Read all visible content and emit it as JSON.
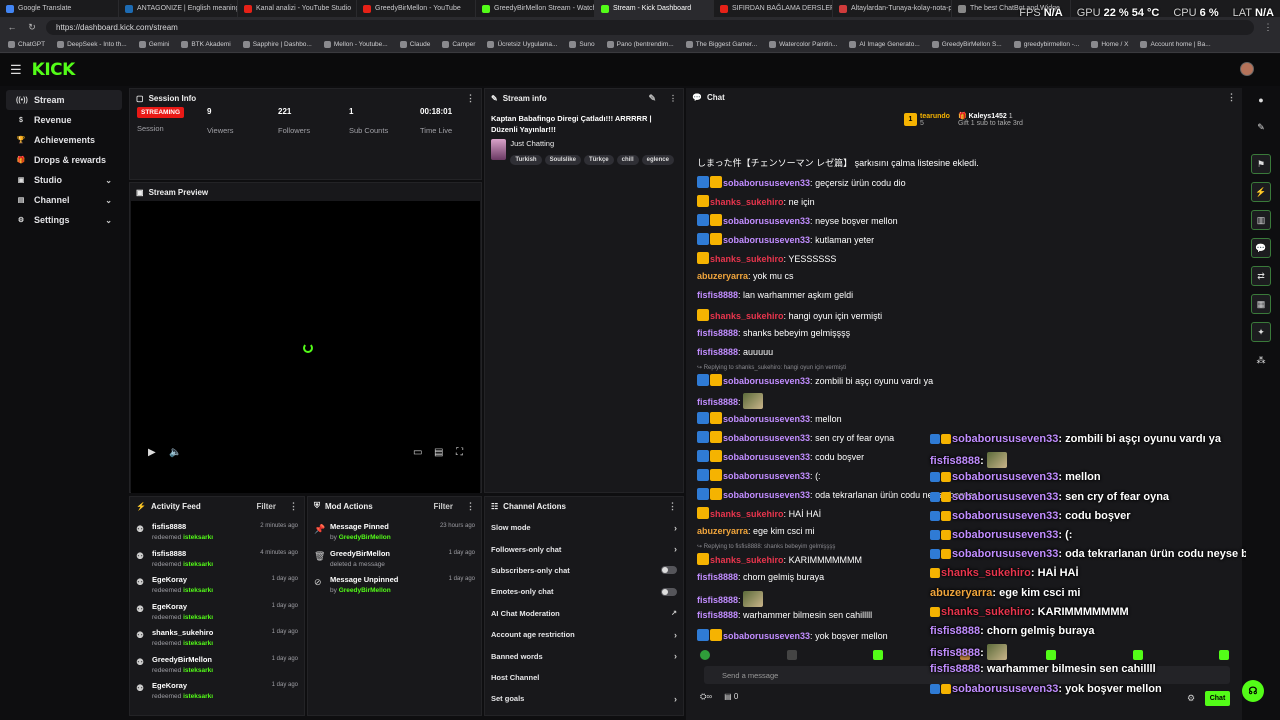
{
  "browser": {
    "tabs": [
      {
        "title": "Google Translate",
        "color": "#4285f4"
      },
      {
        "title": "ANTAGONIZE | English meaning -",
        "color": "#1d6bb3"
      },
      {
        "title": "Kanal analizi - YouTube Studio",
        "color": "#e62117"
      },
      {
        "title": "GreedyBirMellon - YouTube",
        "color": "#e62117"
      },
      {
        "title": "GreedyBirMellon Stream - Watch",
        "color": "#53fc18"
      },
      {
        "title": "Stream - Kick Dashboard",
        "color": "#53fc18"
      },
      {
        "title": "SIFIRDAN BAĞLAMA DERSLERİ 6 (",
        "color": "#e62117"
      },
      {
        "title": "Altaylardan-Tunaya-kolay-nota-p",
        "color": "#d03b3b"
      },
      {
        "title": "The best ChatBot and Widge",
        "color": "#888888"
      }
    ],
    "url": "https://dashboard.kick.com/stream",
    "bookmarks": [
      "ChatGPT",
      "DeepSeek - Into th...",
      "Gemini",
      "BTK Akademi",
      "Sapphire | Dashbo...",
      "Mellon - Youtube...",
      "Claude",
      "Camper",
      "Ücretsiz Uygulama...",
      "Suno",
      "Pano (bentrendim...",
      "The Biggest Gamer...",
      "Watercolor Paintin...",
      "AI Image Generato...",
      "GreedyBirMellon S...",
      "greedybirmellon -...",
      "Home / X",
      "Account home | Ba..."
    ]
  },
  "overlay_stats": {
    "fps_label": "FPS",
    "fps": "N/A",
    "gpu_label": "GPU",
    "gpu": "22 % 54 °C",
    "cpu_label": "CPU",
    "cpu": "6 %",
    "lat_label": "LAT",
    "lat": "N/A"
  },
  "app": {
    "logo": "KICK"
  },
  "sidebar": {
    "items": [
      {
        "label": "Stream",
        "icon": "radio-icon",
        "active": true
      },
      {
        "label": "Revenue",
        "icon": "dollar-icon"
      },
      {
        "label": "Achievements",
        "icon": "trophy-icon"
      },
      {
        "label": "Drops & rewards",
        "icon": "gift-icon"
      },
      {
        "label": "Studio",
        "icon": "studio-icon",
        "chev": true
      },
      {
        "label": "Channel",
        "icon": "channel-icon",
        "chev": true
      },
      {
        "label": "Settings",
        "icon": "gear-icon",
        "chev": true
      }
    ]
  },
  "session": {
    "title": "Session Info",
    "status": "STREAMING",
    "status_label": "Session",
    "viewers": "9",
    "viewers_label": "Viewers",
    "followers": "221",
    "followers_label": "Followers",
    "subs": "1",
    "subs_label": "Sub Counts",
    "time": "00:18:01",
    "time_label": "Time Live"
  },
  "preview": {
    "title": "Stream Preview"
  },
  "stream_info": {
    "title": "Stream info",
    "stream_title": "Kaptan Babafingo Diregi Çatladı!!! ARRRRR | Düzenli Yayınlar!!!",
    "category": "Just Chatting",
    "tags": [
      "Turkish",
      "Soulslike",
      "Türkçe",
      "chill",
      "eglence"
    ]
  },
  "activity": {
    "title": "Activity Feed",
    "filter": "Filter",
    "items": [
      {
        "name": "fisfis8888",
        "action": "redeemed",
        "reward": "isteksarkı",
        "time": "2 minutes ago"
      },
      {
        "name": "fisfis8888",
        "action": "redeemed",
        "reward": "isteksarkı",
        "time": "4 minutes ago"
      },
      {
        "name": "EgeKoray",
        "action": "redeemed",
        "reward": "isteksarkı",
        "time": "1 day ago"
      },
      {
        "name": "EgeKoray",
        "action": "redeemed",
        "reward": "isteksarkı",
        "time": "1 day ago"
      },
      {
        "name": "shanks_sukehiro",
        "action": "redeemed",
        "reward": "isteksarkı",
        "time": "1 day ago"
      },
      {
        "name": "GreedyBirMellon",
        "action": "redeemed",
        "reward": "isteksarkı",
        "time": "1 day ago"
      },
      {
        "name": "EgeKoray",
        "action": "redeemed",
        "reward": "isteksarkı",
        "time": "1 day ago"
      }
    ]
  },
  "mod": {
    "title": "Mod Actions",
    "filter": "Filter",
    "items": [
      {
        "title": "Message Pinned",
        "by": "by",
        "user": "GreedyBirMellon",
        "time": "23 hours ago",
        "icon": "pin-icon"
      },
      {
        "title": "GreedyBirMellon",
        "by": "deleted a message",
        "user": "",
        "time": "1 day ago",
        "icon": "trash-icon"
      },
      {
        "title": "Message Unpinned",
        "by": "by",
        "user": "GreedyBirMellon",
        "time": "1 day ago",
        "icon": "unpin-icon"
      }
    ]
  },
  "channel_actions": {
    "title": "Channel Actions",
    "items": [
      {
        "label": "Slow mode",
        "kind": "arrow"
      },
      {
        "label": "Followers-only chat",
        "kind": "arrow"
      },
      {
        "label": "Subscribers-only chat",
        "kind": "toggle"
      },
      {
        "label": "Emotes-only chat",
        "kind": "toggle"
      },
      {
        "label": "AI Chat Moderation",
        "kind": "ext"
      },
      {
        "label": "Account age restriction",
        "kind": "arrow"
      },
      {
        "label": "Banned words",
        "kind": "arrow"
      },
      {
        "label": "Host Channel",
        "kind": "none"
      },
      {
        "label": "Set goals",
        "kind": "arrow"
      }
    ]
  },
  "chat": {
    "title": "Chat",
    "top_gifter": {
      "rank": "1",
      "name": "tearundo",
      "count": "5"
    },
    "sub_goal": {
      "name": "Kaleys1452",
      "count": "1",
      "text": "Gift 1 sub to take 3rd"
    },
    "bot_line": "しまった件【チェンソーマン レゼ篇】 şarkısını çalma listesine ekledi.",
    "messages": [
      {
        "user": "sobaborususeven33",
        "text": "geçersiz ürün codu dio",
        "color": "#c18dff",
        "badges": [
          "blue",
          "gold"
        ]
      },
      {
        "user": "shanks_sukehiro",
        "text": "ne için",
        "color": "#e8354d",
        "badges": [
          "gold"
        ]
      },
      {
        "user": "sobaborususeven33",
        "text": "neyse boşver mellon",
        "color": "#c18dff",
        "badges": [
          "blue",
          "gold"
        ]
      },
      {
        "user": "sobaborususeven33",
        "text": "kutlaman yeter",
        "color": "#c18dff",
        "badges": [
          "blue",
          "gold"
        ]
      },
      {
        "user": "shanks_sukehiro",
        "text": "YESSSSSS",
        "color": "#e8354d",
        "badges": [
          "gold"
        ]
      },
      {
        "user": "abuzeryarra",
        "text": "yok mu cs",
        "color": "#f0a53c",
        "badges": []
      },
      {
        "user": "fisfis8888",
        "text": "lan warhammer aşkım geldi",
        "color": "#c18dff",
        "badges": []
      },
      {
        "user": "shanks_sukehiro",
        "text": "hangi oyun için vermişti",
        "color": "#e8354d",
        "badges": [
          "gold"
        ]
      },
      {
        "user": "fisfis8888",
        "text": "shanks bebeyim gelmişşşş",
        "color": "#c18dff",
        "badges": []
      },
      {
        "user": "fisfis8888",
        "text": "auuuuu",
        "color": "#c18dff",
        "badges": []
      },
      {
        "user": "sobaborususeven33",
        "text": "zombili bi aşçı oyunu vardı ya",
        "color": "#c18dff",
        "badges": [
          "blue",
          "gold"
        ],
        "reply": "Replying to shanks_sukehiro: hangi oyun için vermişti"
      },
      {
        "user": "fisfis8888",
        "text": "",
        "color": "#c18dff",
        "badges": [],
        "emote": true
      },
      {
        "user": "sobaborususeven33",
        "text": "mellon",
        "color": "#c18dff",
        "badges": [
          "blue",
          "gold"
        ]
      },
      {
        "user": "sobaborususeven33",
        "text": "sen cry of fear oyna",
        "color": "#c18dff",
        "badges": [
          "blue",
          "gold"
        ]
      },
      {
        "user": "sobaborususeven33",
        "text": "codu boşver",
        "color": "#c18dff",
        "badges": [
          "blue",
          "gold"
        ]
      },
      {
        "user": "sobaborususeven33",
        "text": "(:",
        "color": "#c18dff",
        "badges": [
          "blue",
          "gold"
        ]
      },
      {
        "user": "sobaborususeven33",
        "text": "oda tekrarlanan ürün codu neyse boşver",
        "color": "#c18dff",
        "badges": [
          "blue",
          "gold"
        ]
      },
      {
        "user": "shanks_sukehiro",
        "text": "HAİ HAİ",
        "color": "#e8354d",
        "badges": [
          "gold"
        ]
      },
      {
        "user": "abuzeryarra",
        "text": "ege kim csci mi",
        "color": "#f0a53c",
        "badges": []
      },
      {
        "user": "shanks_sukehiro",
        "text": "KARIMMMMMMM",
        "color": "#e8354d",
        "badges": [
          "gold"
        ],
        "reply": "Replying to fisfis8888: shanks bebeyim gelmişşşş"
      },
      {
        "user": "fisfis8888",
        "text": "chorn gelmiş buraya",
        "color": "#c18dff",
        "badges": []
      },
      {
        "user": "fisfis8888",
        "text": "",
        "color": "#c18dff",
        "badges": [],
        "emote": true
      },
      {
        "user": "fisfis8888",
        "text": "warhammer bilmesin sen cahilllll",
        "color": "#c18dff",
        "badges": []
      },
      {
        "user": "sobaborususeven33",
        "text": "yok boşver mellon",
        "color": "#c18dff",
        "badges": [
          "blue",
          "gold"
        ]
      }
    ],
    "input_placeholder": "Send a message",
    "points": "0",
    "send": "Chat"
  },
  "overlay_chat": [
    {
      "user": "sobaborususeven33",
      "text": "zombili bi aşçı oyunu vardı ya",
      "color": "#c18dff",
      "badges": [
        "blue",
        "gold"
      ]
    },
    {
      "user": "fisfis8888",
      "text": "",
      "color": "#c18dff",
      "badges": [],
      "emote": true
    },
    {
      "user": "sobaborususeven33",
      "text": "mellon",
      "color": "#c18dff",
      "badges": [
        "blue",
        "gold"
      ]
    },
    {
      "user": "sobaborususeven33",
      "text": "sen cry of fear oyna",
      "color": "#c18dff",
      "badges": [
        "blue",
        "gold"
      ]
    },
    {
      "user": "sobaborususeven33",
      "text": "codu boşver",
      "color": "#c18dff",
      "badges": [
        "blue",
        "gold"
      ]
    },
    {
      "user": "sobaborususeven33",
      "text": "(:",
      "color": "#c18dff",
      "badges": [
        "blue",
        "gold"
      ]
    },
    {
      "user": "sobaborususeven33",
      "text": "oda tekrarlanan ürün codu neyse boşver",
      "color": "#c18dff",
      "badges": [
        "blue",
        "gold"
      ]
    },
    {
      "user": "shanks_sukehiro",
      "text": "HAİ HAİ",
      "color": "#e8354d",
      "badges": [
        "gold"
      ]
    },
    {
      "user": "abuzeryarra",
      "text": "ege kim csci mi",
      "color": "#f0a53c",
      "badges": []
    },
    {
      "user": "shanks_sukehiro",
      "text": "KARIMMMMMMM",
      "color": "#e8354d",
      "badges": [
        "gold"
      ]
    },
    {
      "user": "fisfis8888",
      "text": "chorn gelmiş buraya",
      "color": "#c18dff",
      "badges": []
    },
    {
      "user": "fisfis8888",
      "text": "",
      "color": "#c18dff",
      "badges": [],
      "emote": true
    },
    {
      "user": "fisfis8888",
      "text": "warhammer bilmesin sen cahillll",
      "color": "#c18dff",
      "badges": []
    },
    {
      "user": "sobaborususeven33",
      "text": "yok boşver mellon",
      "color": "#c18dff",
      "badges": [
        "blue",
        "gold"
      ]
    }
  ],
  "colors": {
    "accent": "#53fc18",
    "live": "#e91916",
    "panel": "#18181b"
  }
}
